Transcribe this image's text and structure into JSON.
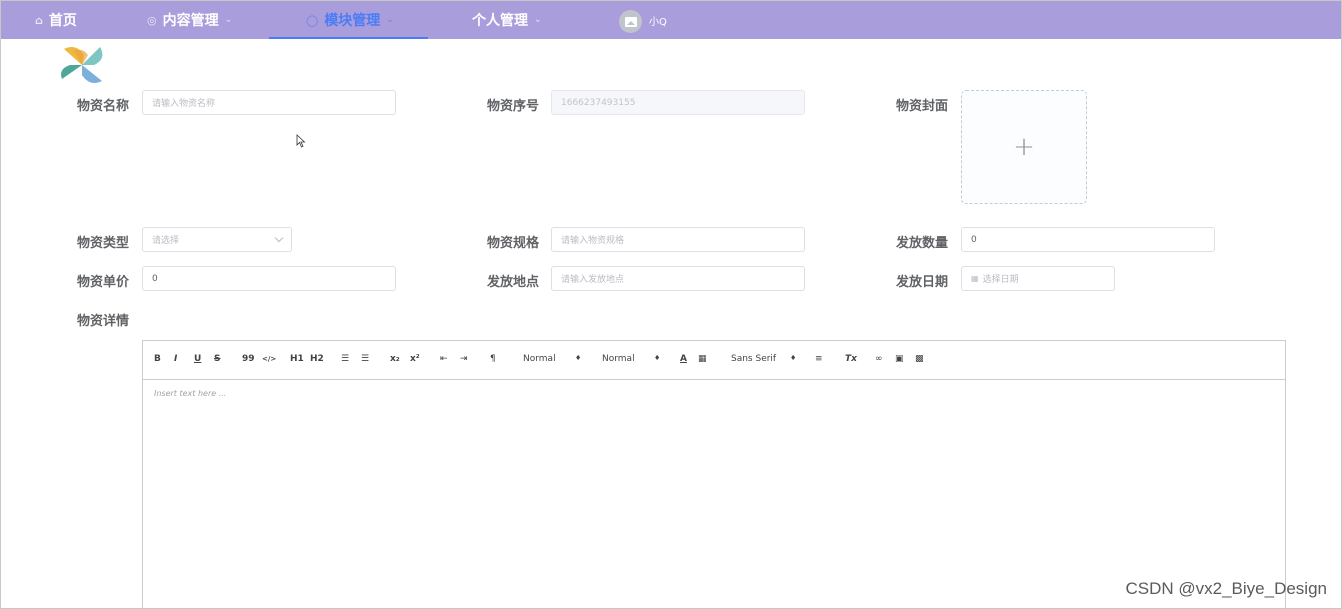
{
  "nav": {
    "items": [
      {
        "label": "首页",
        "icon": "home-icon"
      },
      {
        "label": "内容管理",
        "icon": "content-icon"
      },
      {
        "label": "模块管理",
        "icon": "module-icon"
      },
      {
        "label": "个人管理",
        "icon": ""
      }
    ],
    "active_index": 2,
    "username": "小Q",
    "active_color": "#4a7cf6",
    "bar_color": "#a99ddc"
  },
  "form": {
    "name": {
      "label": "物资名称",
      "placeholder": "请输入物资名称"
    },
    "serial": {
      "label": "物资序号",
      "value": "1666237493155"
    },
    "cover": {
      "label": "物资封面",
      "icon": "plus-icon",
      "glyph": "+"
    },
    "type": {
      "label": "物资类型",
      "placeholder": "请选择"
    },
    "spec": {
      "label": "物资规格",
      "placeholder": "请输入物资规格"
    },
    "quantity": {
      "label": "发放数量",
      "value": "0"
    },
    "price": {
      "label": "物资单价",
      "value": "0"
    },
    "location": {
      "label": "发放地点",
      "placeholder": "请输入发放地点"
    },
    "date": {
      "label": "发放日期",
      "placeholder": "选择日期"
    },
    "details": {
      "label": "物资详情"
    }
  },
  "editor": {
    "toolbar": {
      "bold": "B",
      "italic": "I",
      "underline": "U",
      "strike": "S",
      "quote": "99",
      "code": "</>",
      "h1": "H1",
      "h2": "H2",
      "sub": "x₂",
      "sup": "x²",
      "size": "Normal",
      "header": "Normal",
      "font": "Sans Serif",
      "clean": "Tx"
    },
    "placeholder": "Insert text here ..."
  },
  "watermark": "CSDN @vx2_Biye_Design"
}
